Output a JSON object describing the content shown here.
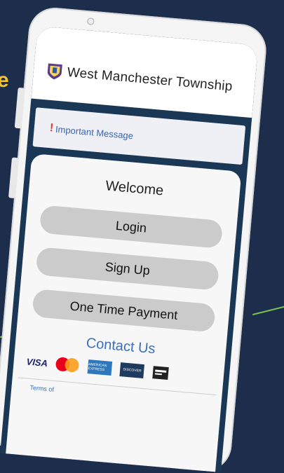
{
  "background": {
    "partial_text": "e",
    "accent": "#7cc24b",
    "bg_color": "#1d2e4d"
  },
  "app": {
    "title": "West Manchester Township",
    "logo_icon": "township-crest-icon"
  },
  "notice": {
    "icon": "exclamation-icon",
    "text": "Important Message",
    "icon_text": "!"
  },
  "card": {
    "welcome": "Welcome",
    "buttons": {
      "login": "Login",
      "signup": "Sign Up",
      "payment": "One Time Payment"
    },
    "contact": "Contact Us",
    "payment_methods": {
      "visa": "VISA",
      "mastercard": "mastercard-icon",
      "amex": "AMERICAN EXPRESS",
      "discover": "DISCOVER",
      "generic": "credit-card-icon"
    },
    "footer": "Terms of"
  }
}
